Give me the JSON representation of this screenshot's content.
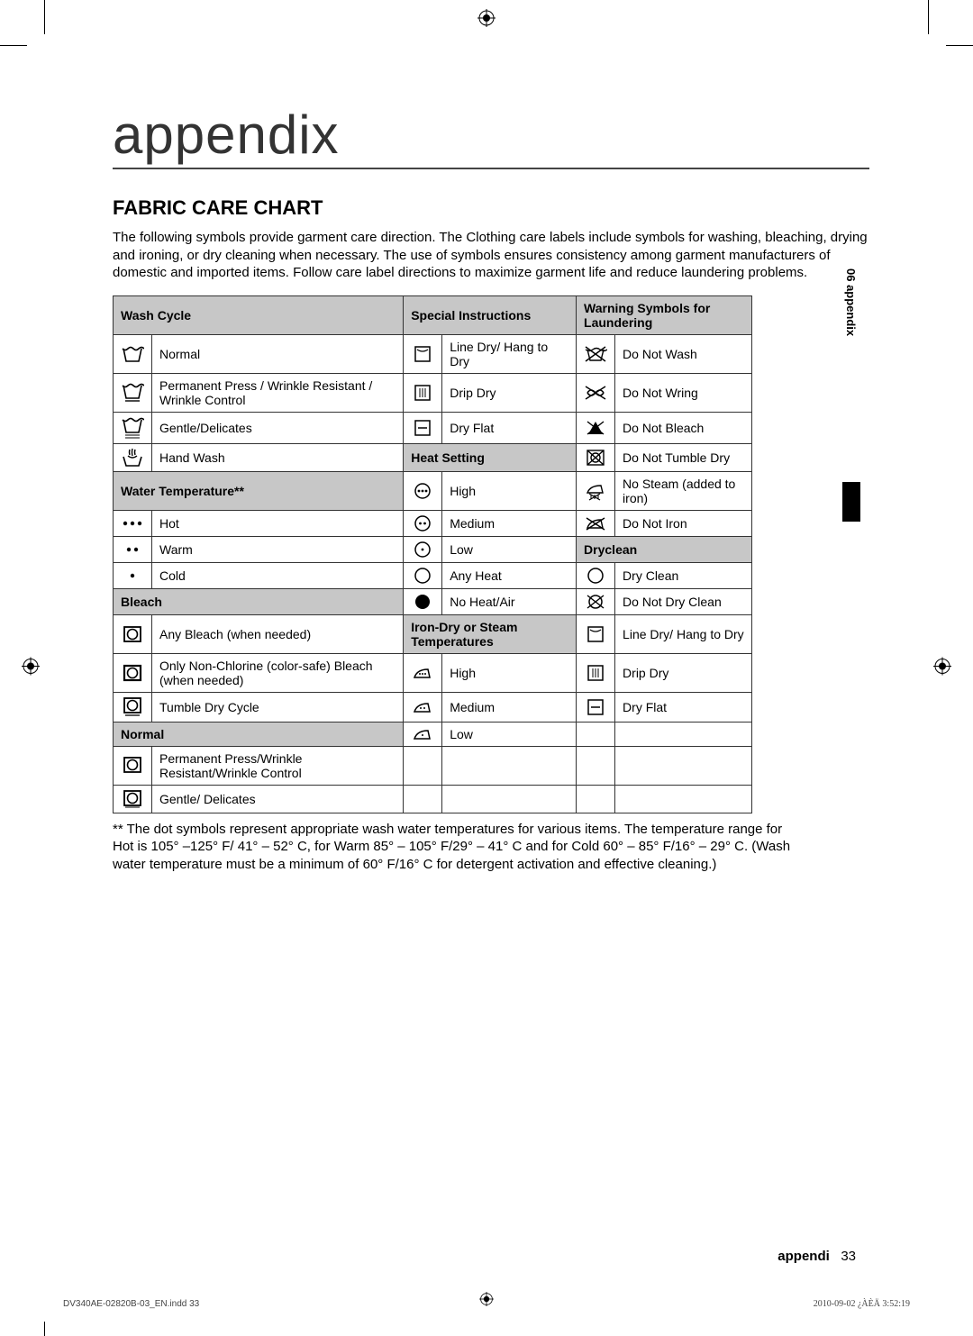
{
  "page_title": "appendix",
  "section_heading": "FABRIC CARE CHART",
  "intro": "The following symbols provide garment care direction. The Clothing care labels include symbols for washing, bleaching, drying and ironing, or dry cleaning when necessary. The use of symbols ensures consistency among garment manufacturers of domestic and imported items. Follow care label directions to maximize garment life and reduce laundering problems.",
  "side_tab": "06 appendix",
  "headers": {
    "wash_cycle": "Wash Cycle",
    "special_instructions": "Special Instructions",
    "warning": "Warning Symbols for Laundering",
    "water_temp": "Water Temperature**",
    "heat_setting": "Heat Setting",
    "dryclean": "Dryclean",
    "bleach": "Bleach",
    "iron_dry": "Iron-Dry or Steam Temperatures",
    "normal": "Normal"
  },
  "rows": {
    "normal": "Normal",
    "perm_press": "Permanent Press / Wrinkle Resistant / Wrinkle Control",
    "gentle": "Gentle/Delicates",
    "hand_wash": "Hand Wash",
    "hot": "Hot",
    "warm": "Warm",
    "cold": "Cold",
    "any_bleach": "Any Bleach (when needed)",
    "non_chlorine": "Only Non-Chlorine (color-safe) Bleach (when needed)",
    "tumble_dry": "Tumble Dry Cycle",
    "perm_press2": "Permanent Press/Wrinkle Resistant/Wrinkle Control",
    "gentle2": "Gentle/ Delicates",
    "line_dry": "Line Dry/ Hang to Dry",
    "drip_dry": "Drip Dry",
    "dry_flat": "Dry Flat",
    "high": "High",
    "medium": "Medium",
    "low": "Low",
    "any_heat": "Any Heat",
    "no_heat": "No Heat/Air",
    "do_not_wash": "Do Not Wash",
    "do_not_wring": "Do Not Wring",
    "do_not_bleach": "Do Not Bleach",
    "do_not_tumble": "Do Not Tumble Dry",
    "no_steam": "No Steam (added to iron)",
    "do_not_iron": "Do Not Iron",
    "dry_clean": "Dry Clean",
    "do_not_dry_clean": "Do Not Dry Clean",
    "line_dry2": "Line Dry/ Hang to Dry",
    "drip_dry2": "Drip Dry",
    "dry_flat2": "Dry Flat"
  },
  "footnote": "** The dot symbols represent appropriate wash water temperatures for various items. The temperature range for Hot is 105° –125° F/ 41° – 52° C, for Warm 85° – 105° F/29° – 41° C and for Cold 60° – 85° F/16° – 29° C. (Wash water temperature must be a minimum of 60° F/16° C for detergent activation and effective cleaning.)",
  "page_num_label": "appendi",
  "page_num": "33",
  "footer_left": "DV340AE-02820B-03_EN.indd   33",
  "footer_right": "2010-09-02   ¿ÀÈÄ 3:52:19"
}
